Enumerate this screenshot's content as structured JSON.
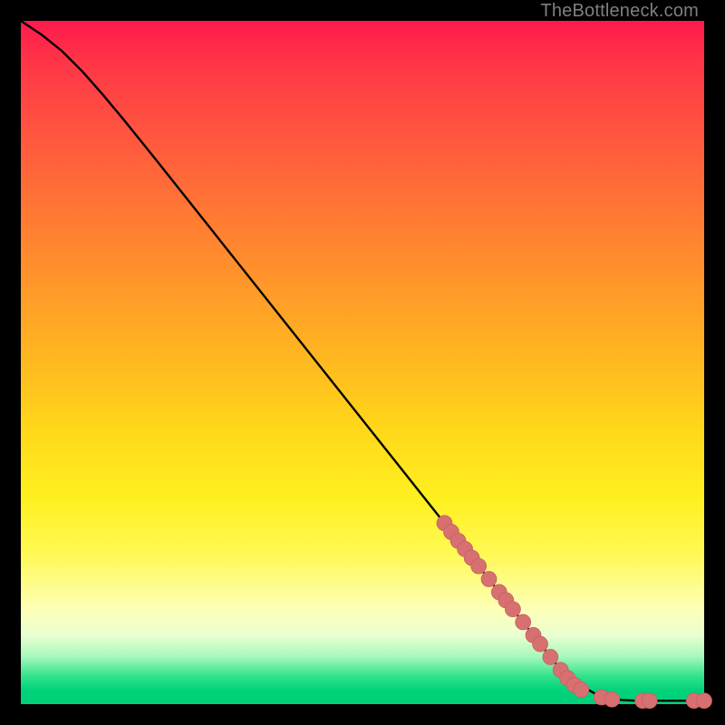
{
  "watermark": "TheBottleneck.com",
  "chart_data": {
    "type": "line",
    "title": "",
    "xlabel": "",
    "ylabel": "",
    "xlim": [
      0,
      100
    ],
    "ylim": [
      0,
      100
    ],
    "grid": false,
    "legend": false,
    "series": [
      {
        "name": "curve",
        "x": [
          0,
          3,
          6,
          9,
          12,
          15,
          20,
          30,
          40,
          50,
          60,
          65,
          70,
          75,
          80,
          85,
          88,
          90,
          92,
          94,
          96,
          98,
          100
        ],
        "y": [
          100,
          98,
          95.6,
          92.6,
          89.2,
          85.6,
          79.4,
          66.8,
          54.2,
          41.6,
          29,
          22.7,
          16.4,
          10.1,
          3.8,
          1.0,
          0.6,
          0.5,
          0.5,
          0.5,
          0.5,
          0.5,
          0.5
        ]
      }
    ],
    "markers": {
      "name": "highlighted-points",
      "color": "#d77070",
      "points": [
        {
          "x": 62,
          "y": 26.5
        },
        {
          "x": 63,
          "y": 25.2
        },
        {
          "x": 64,
          "y": 23.9
        },
        {
          "x": 65,
          "y": 22.7
        },
        {
          "x": 66,
          "y": 21.4
        },
        {
          "x": 67,
          "y": 20.2
        },
        {
          "x": 68.5,
          "y": 18.3
        },
        {
          "x": 70,
          "y": 16.4
        },
        {
          "x": 71,
          "y": 15.2
        },
        {
          "x": 72,
          "y": 13.9
        },
        {
          "x": 73.5,
          "y": 12.0
        },
        {
          "x": 75,
          "y": 10.1
        },
        {
          "x": 76,
          "y": 8.8
        },
        {
          "x": 77.5,
          "y": 6.9
        },
        {
          "x": 79,
          "y": 5.0
        },
        {
          "x": 80,
          "y": 3.8
        },
        {
          "x": 81,
          "y": 2.8
        },
        {
          "x": 82,
          "y": 2.1
        },
        {
          "x": 85,
          "y": 1.0
        },
        {
          "x": 86.5,
          "y": 0.7
        },
        {
          "x": 91,
          "y": 0.5
        },
        {
          "x": 92,
          "y": 0.5
        },
        {
          "x": 98.5,
          "y": 0.5
        },
        {
          "x": 100,
          "y": 0.5
        }
      ]
    }
  }
}
